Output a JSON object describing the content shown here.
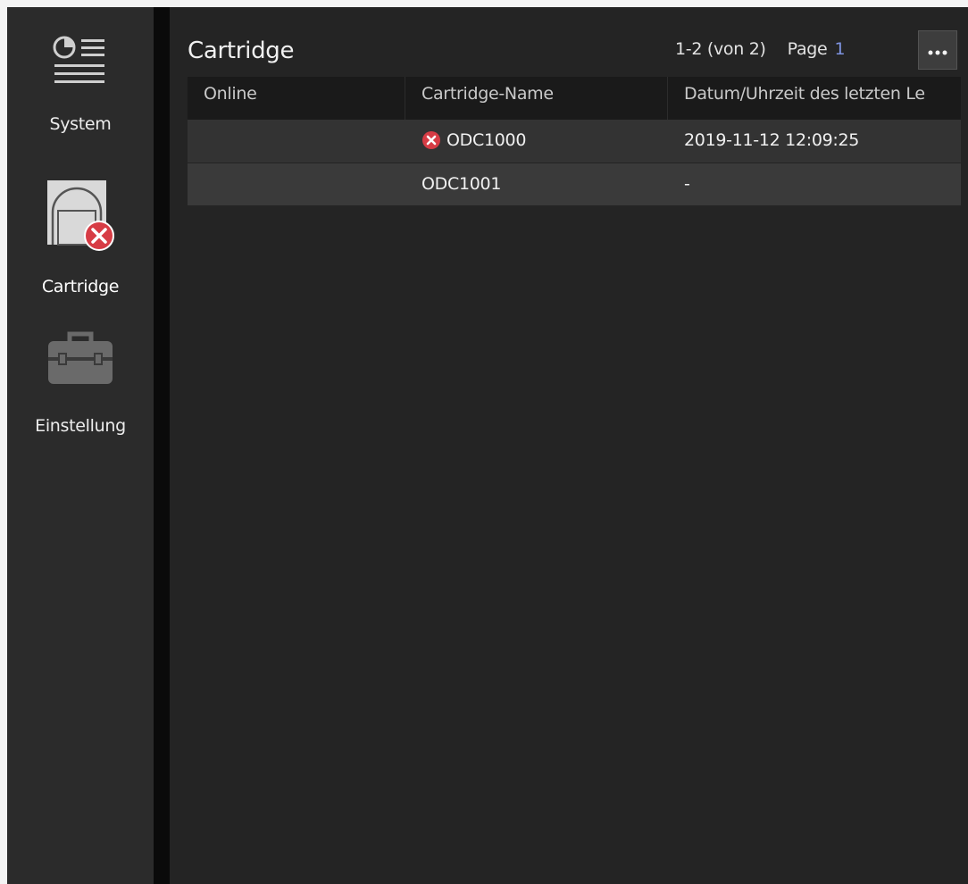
{
  "colors": {
    "page_bg": "#242424",
    "sidebar_bg": "#2b2b2b",
    "error_red": "#d73c45",
    "page_link": "#7e93e0"
  },
  "sidebar": {
    "items": [
      {
        "label": "System",
        "icon": "system-list-icon",
        "active": false
      },
      {
        "label": "Cartridge",
        "icon": "cartridge-icon",
        "active": true,
        "status_icon": "error-x-icon"
      },
      {
        "label": "Einstellung",
        "icon": "toolbox-icon",
        "active": false
      }
    ]
  },
  "header": {
    "title": "Cartridge",
    "range_text": "1-2 (von 2)",
    "page_label": "Page",
    "page_number": "1",
    "more_icon": "more-dots-icon"
  },
  "table": {
    "columns": [
      "Online",
      "Cartridge-Name",
      "Datum/Uhrzeit des letzten Le"
    ],
    "rows": [
      {
        "online": "",
        "name": "ODC1000",
        "status_icon": "error-x-icon",
        "date": "2019-11-12 12:09:25"
      },
      {
        "online": "",
        "name": "ODC1001",
        "status_icon": "",
        "date": "-"
      }
    ]
  }
}
